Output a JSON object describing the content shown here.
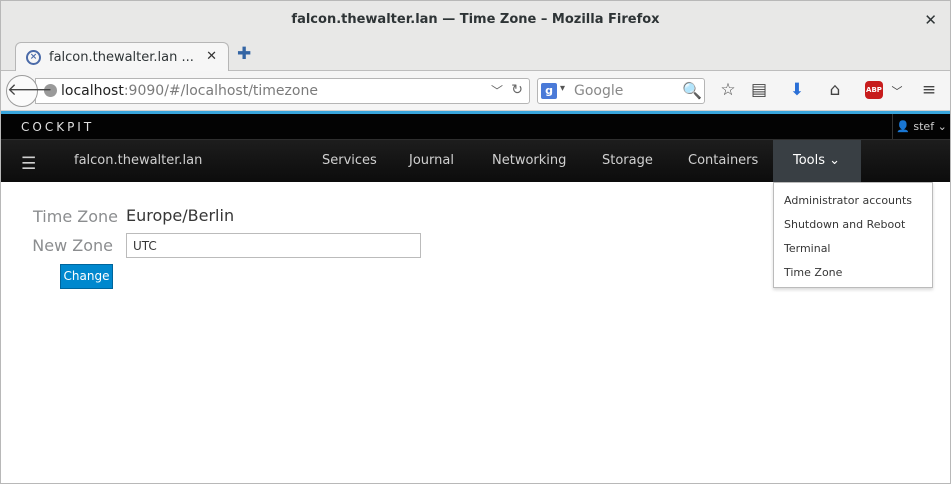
{
  "window": {
    "title": "falcon.thewalter.lan — Time Zone – Mozilla Firefox",
    "close_glyph": "✕"
  },
  "tab": {
    "title": "falcon.thewalter.lan ...",
    "close_glyph": "✕",
    "new_tab_glyph": "✚"
  },
  "address": {
    "host": "localhost",
    "rest": ":9090/#/localhost/timezone"
  },
  "search": {
    "placeholder": "Google",
    "engine_icon": "google-icon"
  },
  "cockpit": {
    "brand": "COCKPIT",
    "user": "stef",
    "hostname": "falcon.thewalter.lan",
    "nav": [
      "Services",
      "Journal",
      "Networking",
      "Storage",
      "Containers"
    ],
    "tools_label": "Tools",
    "tools_menu": [
      "Administrator accounts",
      "Shutdown and Reboot",
      "Terminal",
      "Time Zone"
    ]
  },
  "timezone": {
    "current_label": "Time Zone",
    "current_value": "Europe/Berlin",
    "new_label": "New Zone",
    "new_value": "UTC",
    "change_button": "Change"
  },
  "colors": {
    "accent": "#39a5dc",
    "primary_button": "#0088ce",
    "abp": "#c71c1c"
  }
}
